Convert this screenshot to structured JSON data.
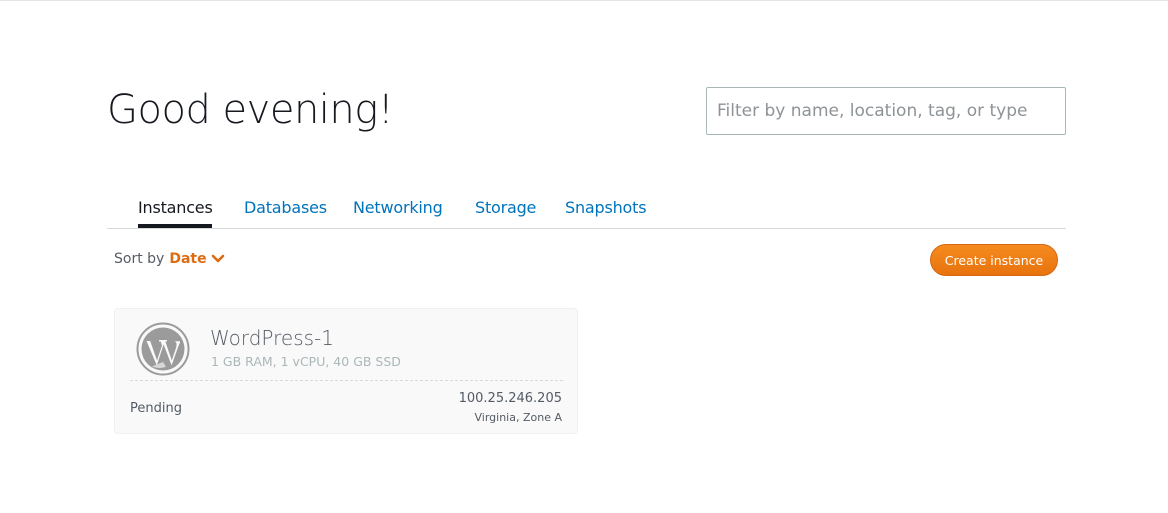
{
  "header": {
    "greeting": "Good evening!",
    "filter_placeholder": "Filter by name, location, tag, or type"
  },
  "tabs": [
    {
      "label": "Instances",
      "active": true
    },
    {
      "label": "Databases",
      "active": false
    },
    {
      "label": "Networking",
      "active": false
    },
    {
      "label": "Storage",
      "active": false
    },
    {
      "label": "Snapshots",
      "active": false
    }
  ],
  "sort": {
    "label": "Sort by",
    "value": "Date",
    "icon": "chevron-down-icon"
  },
  "actions": {
    "create_label": "Create instance"
  },
  "instances": [
    {
      "icon": "wordpress-icon",
      "name": "WordPress-1",
      "specs": "1 GB RAM, 1 vCPU, 40 GB SSD",
      "status": "Pending",
      "ip": "100.25.246.205",
      "region": "Virginia, Zone A"
    }
  ],
  "colors": {
    "accent": "#dd6b10",
    "link": "#0073bb",
    "button": "#ec7211",
    "text": "#16191f",
    "muted": "#aab7b8"
  }
}
